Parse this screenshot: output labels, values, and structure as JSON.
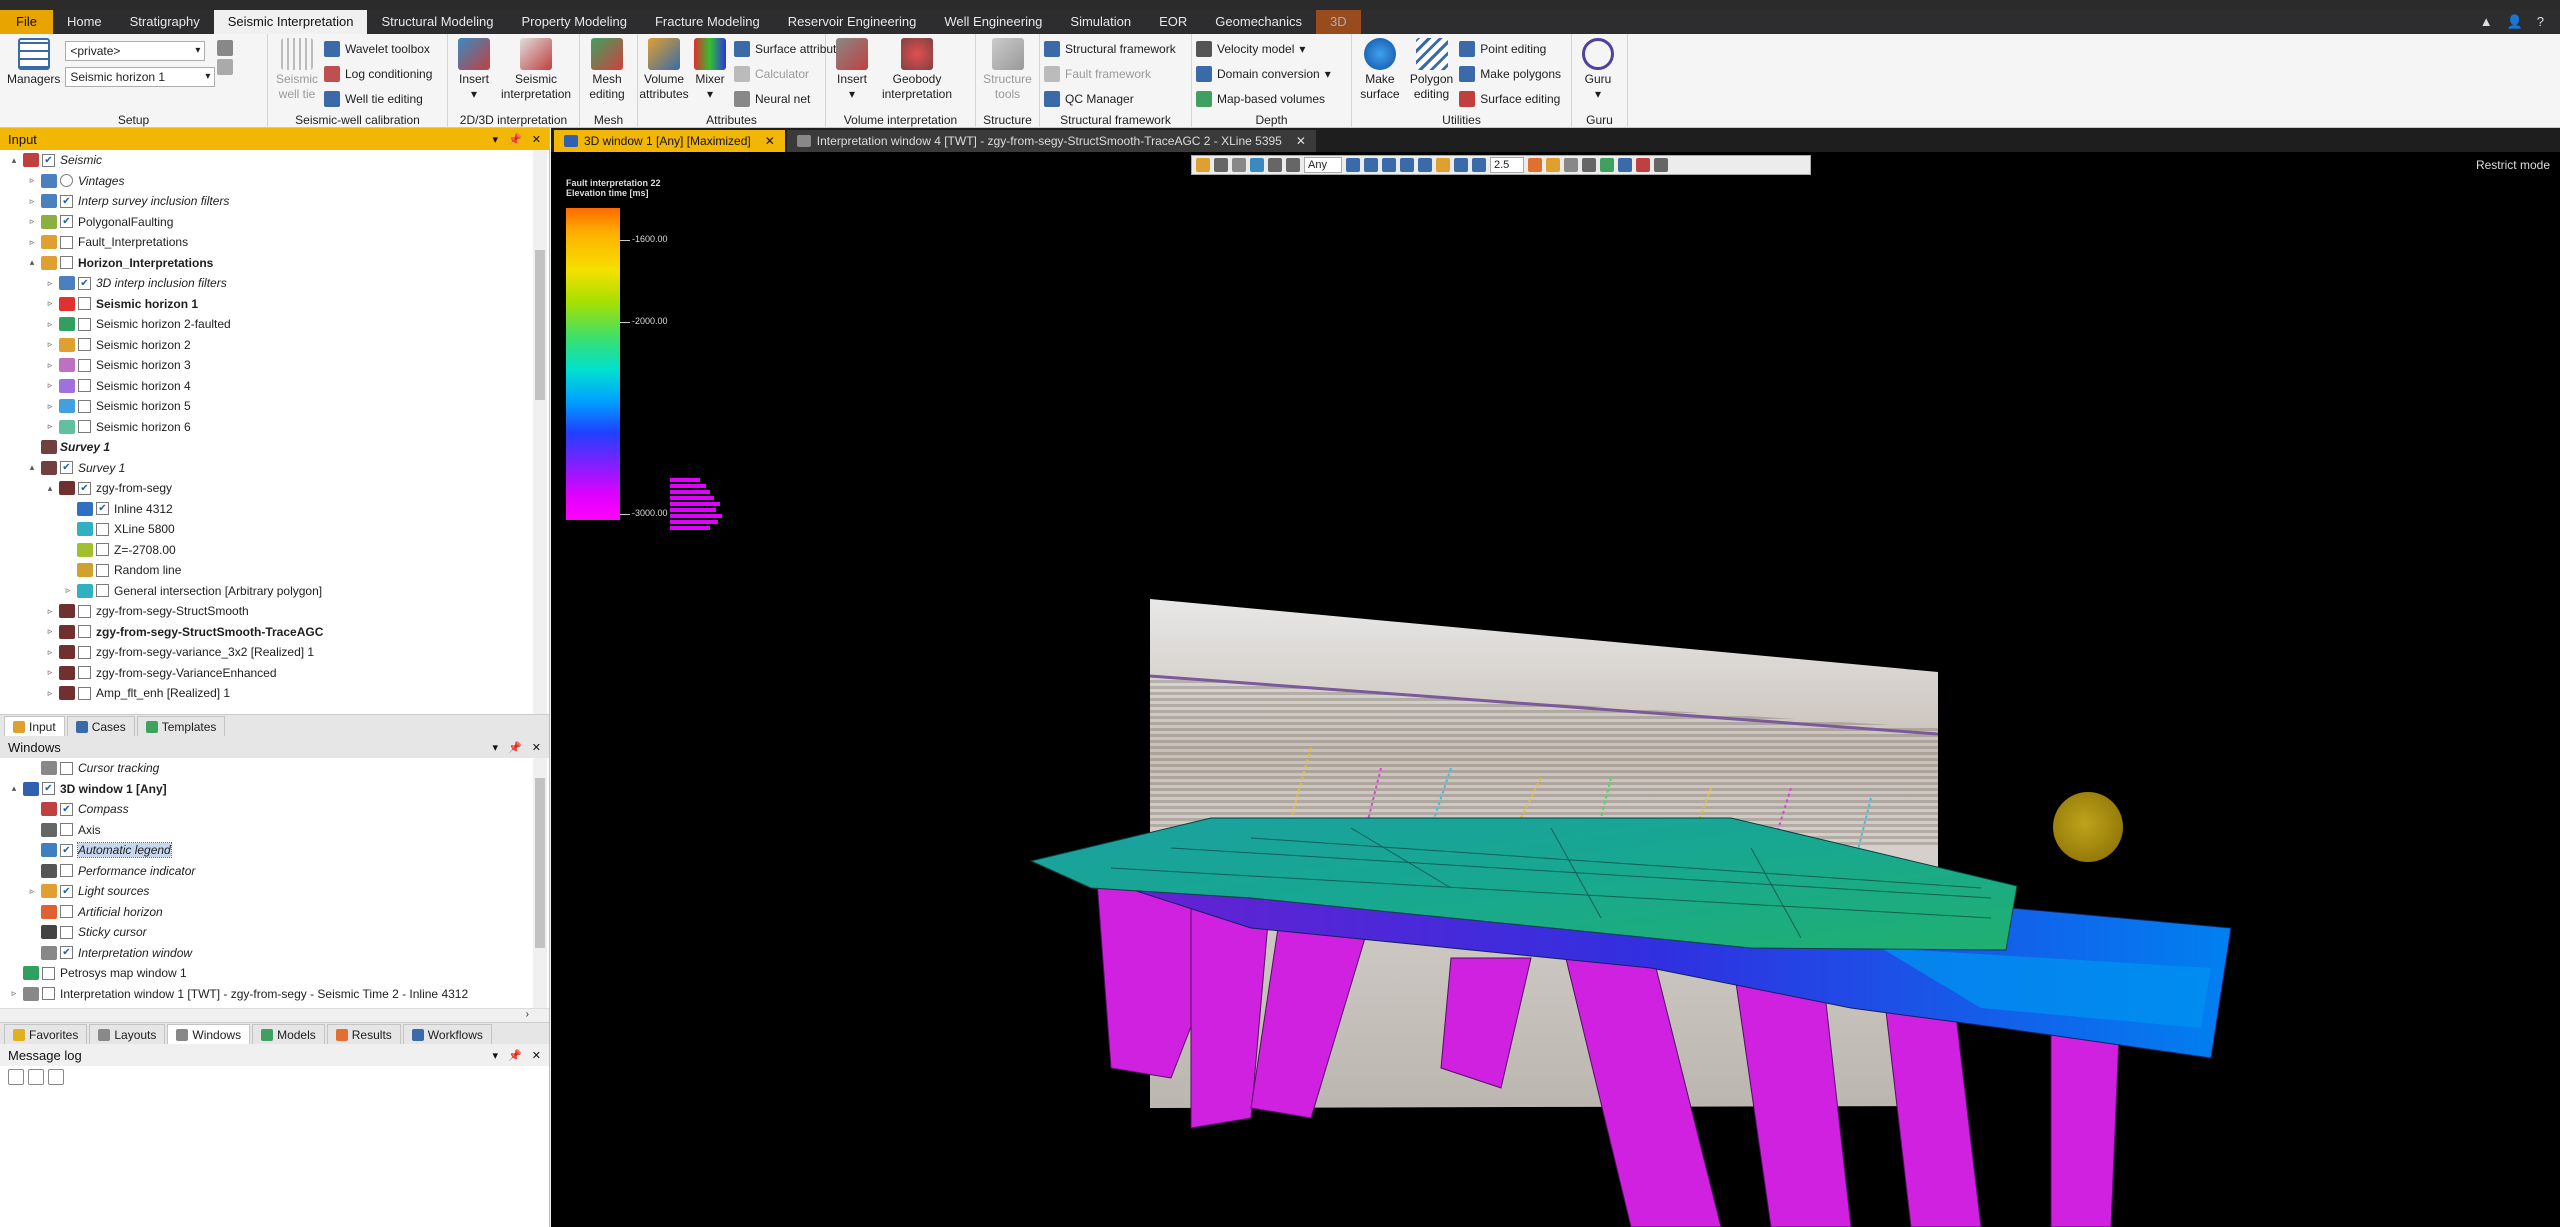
{
  "menubar": {
    "items": [
      "File",
      "Home",
      "Stratigraphy",
      "Seismic Interpretation",
      "Structural Modeling",
      "Property Modeling",
      "Fracture Modeling",
      "Reservoir Engineering",
      "Well Engineering",
      "Simulation",
      "EOR",
      "Geomechanics",
      "3D"
    ],
    "active": "Seismic Interpretation"
  },
  "ribbon": {
    "setup": {
      "label": "Setup",
      "managers": "Managers",
      "private_combo": "<private>",
      "horizon_combo": "Seismic horizon 1"
    },
    "seismic_well": {
      "label": "Seismic-well calibration",
      "seismic_well_tie": "Seismic well tie",
      "wavelet_toolbox": "Wavelet toolbox",
      "log_conditioning": "Log conditioning",
      "well_tie_editing": "Well tie editing"
    },
    "interp2d3d": {
      "label": "2D/3D interpretation",
      "insert": "Insert",
      "seismic_interpretation": "Seismic interpretation"
    },
    "mesh": {
      "label": "Mesh",
      "mesh_editing": "Mesh editing"
    },
    "attributes": {
      "label": "Attributes",
      "volume_attributes": "Volume attributes",
      "mixer": "Mixer",
      "surface_attributes": "Surface attributes",
      "calculator": "Calculator",
      "neural_net": "Neural net"
    },
    "volume_interp": {
      "label": "Volume interpretation",
      "insert": "Insert",
      "geobody_interpretation": "Geobody interpretation"
    },
    "structure": {
      "label": "Structure",
      "structure_tools": "Structure tools"
    },
    "structural_framework": {
      "label": "Structural framework",
      "structural_framework": "Structural framework",
      "fault_framework": "Fault framework",
      "qc_manager": "QC Manager"
    },
    "depth": {
      "label": "Depth",
      "velocity_model": "Velocity model",
      "domain_conversion": "Domain conversion",
      "map_based_volumes": "Map-based volumes"
    },
    "utilities": {
      "label": "Utilities",
      "make_surface": "Make surface",
      "polygon_editing": "Polygon editing",
      "point_editing": "Point editing",
      "make_polygons": "Make polygons",
      "surface_editing": "Surface editing"
    },
    "guru": {
      "label": "Guru",
      "guru": "Guru"
    }
  },
  "input_pane": {
    "title": "Input",
    "rows": [
      {
        "label": "Seismic",
        "level": 0,
        "exp": "▴",
        "check": true,
        "italic": true,
        "icon": "#c04040"
      },
      {
        "label": "Vintages",
        "level": 1,
        "exp": "▹",
        "radio": true,
        "italic": true,
        "icon": "#4a7fc0"
      },
      {
        "label": "Interp survey inclusion filters",
        "level": 1,
        "exp": "▹",
        "check": true,
        "italic": true,
        "icon": "#4a7fc0"
      },
      {
        "label": "PolygonalFaulting",
        "level": 1,
        "exp": "▹",
        "check": true,
        "icon": "#8bb040"
      },
      {
        "label": "Fault_Interpretations",
        "level": 1,
        "exp": "▹",
        "check": false,
        "icon": "#e0a030"
      },
      {
        "label": "Horizon_Interpretations",
        "level": 1,
        "exp": "▴",
        "check": false,
        "bold": true,
        "icon": "#e0a030"
      },
      {
        "label": "3D interp inclusion filters",
        "level": 2,
        "exp": "▹",
        "check": true,
        "italic": true,
        "icon": "#4a7fc0"
      },
      {
        "label": "Seismic horizon 1",
        "level": 2,
        "exp": "▹",
        "check": false,
        "bold": true,
        "icon": "#e03030"
      },
      {
        "label": "Seismic horizon 2-faulted",
        "level": 2,
        "exp": "▹",
        "check": false,
        "icon": "#30a060"
      },
      {
        "label": "Seismic horizon 2",
        "level": 2,
        "exp": "▹",
        "check": false,
        "icon": "#e0a030"
      },
      {
        "label": "Seismic horizon 3",
        "level": 2,
        "exp": "▹",
        "check": false,
        "icon": "#c070c0"
      },
      {
        "label": "Seismic horizon 4",
        "level": 2,
        "exp": "▹",
        "check": false,
        "icon": "#a070e0"
      },
      {
        "label": "Seismic horizon 5",
        "level": 2,
        "exp": "▹",
        "check": false,
        "icon": "#40a0e0"
      },
      {
        "label": "Seismic horizon 6",
        "level": 2,
        "exp": "▹",
        "check": false,
        "icon": "#60c0a0"
      },
      {
        "label": "Survey 1",
        "level": 1,
        "exp": "",
        "noCheck": true,
        "italic": true,
        "bold": true,
        "icon": "#704040"
      },
      {
        "label": "Survey 1",
        "level": 1,
        "exp": "▴",
        "check": true,
        "italic": true,
        "icon": "#704040"
      },
      {
        "label": "zgy-from-segy",
        "level": 2,
        "exp": "▴",
        "check": true,
        "icon": "#703030"
      },
      {
        "label": "Inline 4312",
        "level": 3,
        "exp": "",
        "check": true,
        "icon": "#3070c0"
      },
      {
        "label": "XLine 5800",
        "level": 3,
        "exp": "",
        "check": false,
        "icon": "#30b0c0"
      },
      {
        "label": "Z=-2708.00",
        "level": 3,
        "exp": "",
        "check": false,
        "icon": "#a0c030"
      },
      {
        "label": "Random line",
        "level": 3,
        "exp": "",
        "check": false,
        "icon": "#d0a030"
      },
      {
        "label": "General intersection [Arbitrary polygon]",
        "level": 3,
        "exp": "▹",
        "check": false,
        "icon": "#30b0c0"
      },
      {
        "label": "zgy-from-segy-StructSmooth",
        "level": 2,
        "exp": "▹",
        "check": false,
        "icon": "#703030"
      },
      {
        "label": "zgy-from-segy-StructSmooth-TraceAGC",
        "level": 2,
        "exp": "▹",
        "check": false,
        "bold": true,
        "icon": "#703030"
      },
      {
        "label": "zgy-from-segy-variance_3x2 [Realized] 1",
        "level": 2,
        "exp": "▹",
        "check": false,
        "icon": "#703030"
      },
      {
        "label": "zgy-from-segy-VarianceEnhanced",
        "level": 2,
        "exp": "▹",
        "check": false,
        "icon": "#703030"
      },
      {
        "label": "Amp_flt_enh [Realized] 1",
        "level": 2,
        "exp": "▹",
        "check": false,
        "icon": "#703030"
      }
    ],
    "tabs": [
      "Input",
      "Cases",
      "Templates"
    ]
  },
  "windows_pane": {
    "title": "Windows",
    "rows": [
      {
        "label": "Cursor tracking",
        "level": 1,
        "exp": "",
        "check": false,
        "italic": true,
        "icon": "#888888"
      },
      {
        "label": "3D window 1 [Any]",
        "level": 0,
        "exp": "▴",
        "check": true,
        "bold": true,
        "icon": "#3060b0"
      },
      {
        "label": "Compass",
        "level": 1,
        "exp": "",
        "check": true,
        "italic": true,
        "icon": "#c04040"
      },
      {
        "label": "Axis",
        "level": 1,
        "exp": "",
        "check": false,
        "icon": "#666666"
      },
      {
        "label": "Automatic legend",
        "level": 1,
        "exp": "",
        "check": true,
        "italic": true,
        "sel": true,
        "icon": "#4080c0"
      },
      {
        "label": "Performance indicator",
        "level": 1,
        "exp": "",
        "check": false,
        "italic": true,
        "icon": "#555555"
      },
      {
        "label": "Light sources",
        "level": 1,
        "exp": "▹",
        "check": true,
        "italic": true,
        "icon": "#e0a030"
      },
      {
        "label": "Artificial horizon",
        "level": 1,
        "exp": "",
        "check": false,
        "italic": true,
        "icon": "#e06030"
      },
      {
        "label": "Sticky cursor",
        "level": 1,
        "exp": "",
        "check": false,
        "italic": true,
        "icon": "#444444"
      },
      {
        "label": "Interpretation window",
        "level": 1,
        "exp": "",
        "check": true,
        "italic": true,
        "icon": "#888888"
      },
      {
        "label": "Petrosys map window 1",
        "level": 0,
        "exp": "",
        "check": false,
        "icon": "#30a060"
      },
      {
        "label": "Interpretation window 1 [TWT] - zgy-from-segy - Seismic Time 2 - Inline 4312",
        "level": 0,
        "exp": "▹",
        "check": false,
        "icon": "#888888"
      }
    ],
    "tabs": [
      "Favorites",
      "Layouts",
      "Windows",
      "Models",
      "Results",
      "Workflows"
    ]
  },
  "message_log": {
    "title": "Message log"
  },
  "view": {
    "tabs": [
      {
        "label": "3D window 1 [Any] [Maximized]",
        "active": true
      },
      {
        "label": "Interpretation window 4 [TWT] - zgy-from-segy-StructSmooth-TraceAGC 2 - XLine 5395",
        "active": false
      }
    ],
    "restrict_mode": "Restrict mode",
    "toolbar": {
      "domain": "Any",
      "zoom": "2.5"
    },
    "legend": {
      "title": "Fault interpretation 22",
      "subtitle": "Elevation time [ms]",
      "ticks": [
        "-1600.00",
        "-2000.00",
        "-3000.00"
      ]
    }
  },
  "colors": {
    "accent": "#f2b705",
    "menubar": "#2d2d30",
    "view_bg": "#000000"
  }
}
